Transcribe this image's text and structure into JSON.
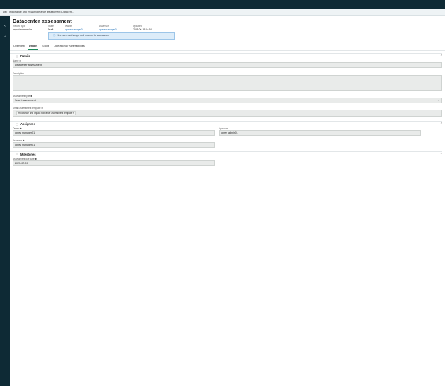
{
  "breadcrumb": {
    "root": "List",
    "current": "Importance and impact tolerance assessment: Datacent..."
  },
  "page": {
    "title": "Datacenter assessment"
  },
  "meta": [
    {
      "label": "Record type",
      "value": "Importance and im..."
    },
    {
      "label": "State",
      "value": "Draft"
    },
    {
      "label": "Owner",
      "value": "opres manager01"
    },
    {
      "label": "Assessor",
      "value": "opres manager01"
    },
    {
      "label": "Updated",
      "value": "2025-06-25 14:54 ..."
    }
  ],
  "info": {
    "icon": "info-icon",
    "text": "Next step: Add scope and proceed to assessment"
  },
  "tabs": [
    "Overview",
    "Details",
    "Scope",
    "Operational vulnerabilities"
  ],
  "active_tab": "Details",
  "details": {
    "title": "Details",
    "name_label": "Name",
    "name_value": "Datacenter assessment",
    "description_label": "Description",
    "description_value": "",
    "assessment_type_label": "Assessment type",
    "assessment_type_value": "Smart assessment",
    "template_label": "Smart assessment template",
    "template_value": "Importance and impact tolerance assessment template"
  },
  "assignees": {
    "title": "Assignees",
    "owner_label": "Owner",
    "owner_value": "opres manager01",
    "approver_label": "Approver",
    "approver_value": "opres admin01",
    "assessor_label": "Assessor",
    "assessor_value": "opres manager01"
  },
  "milestones": {
    "title": "Milestones",
    "due_label": "Assessment due date",
    "due_value": "2025-07-09"
  },
  "icons": {
    "sidebar": [
      "chevron-left-icon",
      "arrow-right-icon"
    ]
  },
  "colors": {
    "nav_bg": "#0e2a35",
    "active_tab": "#1a8a5a",
    "link": "#1d6fb8",
    "info_bg": "#dcecf9"
  }
}
